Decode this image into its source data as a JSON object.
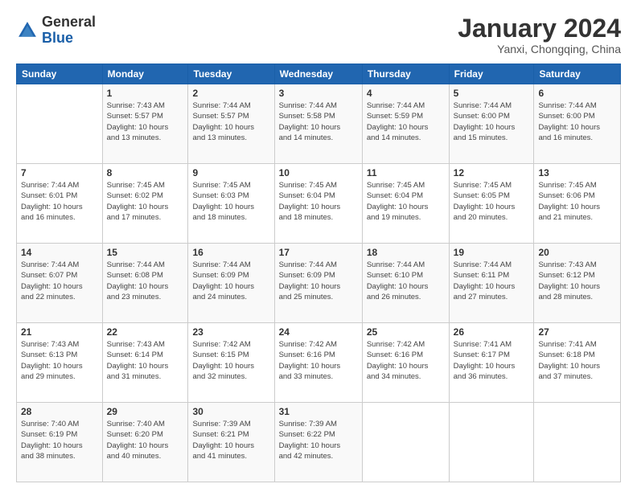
{
  "header": {
    "logo": {
      "line1": "General",
      "line2": "Blue"
    },
    "title": "January 2024",
    "subtitle": "Yanxi, Chongqing, China"
  },
  "days_of_week": [
    "Sunday",
    "Monday",
    "Tuesday",
    "Wednesday",
    "Thursday",
    "Friday",
    "Saturday"
  ],
  "weeks": [
    [
      {
        "day": "",
        "info": ""
      },
      {
        "day": "1",
        "info": "Sunrise: 7:43 AM\nSunset: 5:57 PM\nDaylight: 10 hours\nand 13 minutes."
      },
      {
        "day": "2",
        "info": "Sunrise: 7:44 AM\nSunset: 5:57 PM\nDaylight: 10 hours\nand 13 minutes."
      },
      {
        "day": "3",
        "info": "Sunrise: 7:44 AM\nSunset: 5:58 PM\nDaylight: 10 hours\nand 14 minutes."
      },
      {
        "day": "4",
        "info": "Sunrise: 7:44 AM\nSunset: 5:59 PM\nDaylight: 10 hours\nand 14 minutes."
      },
      {
        "day": "5",
        "info": "Sunrise: 7:44 AM\nSunset: 6:00 PM\nDaylight: 10 hours\nand 15 minutes."
      },
      {
        "day": "6",
        "info": "Sunrise: 7:44 AM\nSunset: 6:00 PM\nDaylight: 10 hours\nand 16 minutes."
      }
    ],
    [
      {
        "day": "7",
        "info": "Sunrise: 7:44 AM\nSunset: 6:01 PM\nDaylight: 10 hours\nand 16 minutes."
      },
      {
        "day": "8",
        "info": "Sunrise: 7:45 AM\nSunset: 6:02 PM\nDaylight: 10 hours\nand 17 minutes."
      },
      {
        "day": "9",
        "info": "Sunrise: 7:45 AM\nSunset: 6:03 PM\nDaylight: 10 hours\nand 18 minutes."
      },
      {
        "day": "10",
        "info": "Sunrise: 7:45 AM\nSunset: 6:04 PM\nDaylight: 10 hours\nand 18 minutes."
      },
      {
        "day": "11",
        "info": "Sunrise: 7:45 AM\nSunset: 6:04 PM\nDaylight: 10 hours\nand 19 minutes."
      },
      {
        "day": "12",
        "info": "Sunrise: 7:45 AM\nSunset: 6:05 PM\nDaylight: 10 hours\nand 20 minutes."
      },
      {
        "day": "13",
        "info": "Sunrise: 7:45 AM\nSunset: 6:06 PM\nDaylight: 10 hours\nand 21 minutes."
      }
    ],
    [
      {
        "day": "14",
        "info": "Sunrise: 7:44 AM\nSunset: 6:07 PM\nDaylight: 10 hours\nand 22 minutes."
      },
      {
        "day": "15",
        "info": "Sunrise: 7:44 AM\nSunset: 6:08 PM\nDaylight: 10 hours\nand 23 minutes."
      },
      {
        "day": "16",
        "info": "Sunrise: 7:44 AM\nSunset: 6:09 PM\nDaylight: 10 hours\nand 24 minutes."
      },
      {
        "day": "17",
        "info": "Sunrise: 7:44 AM\nSunset: 6:09 PM\nDaylight: 10 hours\nand 25 minutes."
      },
      {
        "day": "18",
        "info": "Sunrise: 7:44 AM\nSunset: 6:10 PM\nDaylight: 10 hours\nand 26 minutes."
      },
      {
        "day": "19",
        "info": "Sunrise: 7:44 AM\nSunset: 6:11 PM\nDaylight: 10 hours\nand 27 minutes."
      },
      {
        "day": "20",
        "info": "Sunrise: 7:43 AM\nSunset: 6:12 PM\nDaylight: 10 hours\nand 28 minutes."
      }
    ],
    [
      {
        "day": "21",
        "info": "Sunrise: 7:43 AM\nSunset: 6:13 PM\nDaylight: 10 hours\nand 29 minutes."
      },
      {
        "day": "22",
        "info": "Sunrise: 7:43 AM\nSunset: 6:14 PM\nDaylight: 10 hours\nand 31 minutes."
      },
      {
        "day": "23",
        "info": "Sunrise: 7:42 AM\nSunset: 6:15 PM\nDaylight: 10 hours\nand 32 minutes."
      },
      {
        "day": "24",
        "info": "Sunrise: 7:42 AM\nSunset: 6:16 PM\nDaylight: 10 hours\nand 33 minutes."
      },
      {
        "day": "25",
        "info": "Sunrise: 7:42 AM\nSunset: 6:16 PM\nDaylight: 10 hours\nand 34 minutes."
      },
      {
        "day": "26",
        "info": "Sunrise: 7:41 AM\nSunset: 6:17 PM\nDaylight: 10 hours\nand 36 minutes."
      },
      {
        "day": "27",
        "info": "Sunrise: 7:41 AM\nSunset: 6:18 PM\nDaylight: 10 hours\nand 37 minutes."
      }
    ],
    [
      {
        "day": "28",
        "info": "Sunrise: 7:40 AM\nSunset: 6:19 PM\nDaylight: 10 hours\nand 38 minutes."
      },
      {
        "day": "29",
        "info": "Sunrise: 7:40 AM\nSunset: 6:20 PM\nDaylight: 10 hours\nand 40 minutes."
      },
      {
        "day": "30",
        "info": "Sunrise: 7:39 AM\nSunset: 6:21 PM\nDaylight: 10 hours\nand 41 minutes."
      },
      {
        "day": "31",
        "info": "Sunrise: 7:39 AM\nSunset: 6:22 PM\nDaylight: 10 hours\nand 42 minutes."
      },
      {
        "day": "",
        "info": ""
      },
      {
        "day": "",
        "info": ""
      },
      {
        "day": "",
        "info": ""
      }
    ]
  ]
}
